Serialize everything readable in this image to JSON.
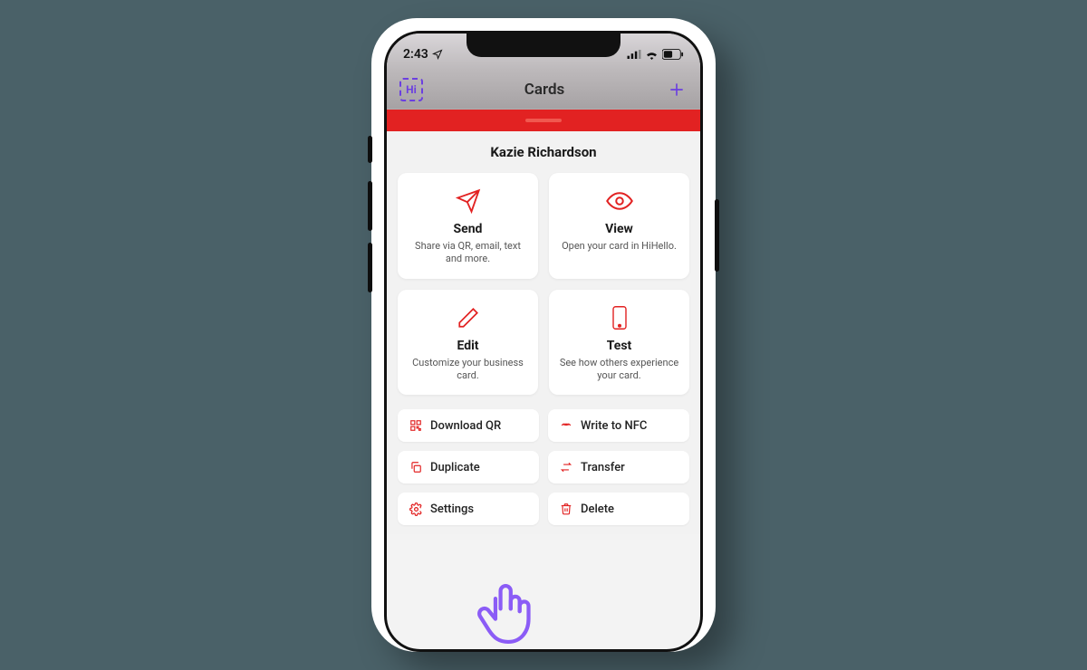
{
  "status": {
    "time": "2:43"
  },
  "nav": {
    "logo_text": "Hi",
    "title": "Cards"
  },
  "card_name": "Kazie Richardson",
  "tiles": {
    "send": {
      "title": "Send",
      "sub": "Share via QR, email, text and more."
    },
    "view": {
      "title": "View",
      "sub": "Open your card in HiHello."
    },
    "edit": {
      "title": "Edit",
      "sub": "Customize your business card."
    },
    "test": {
      "title": "Test",
      "sub": "See how others experience your card."
    }
  },
  "actions": {
    "download_qr": "Download QR",
    "write_nfc": "Write to NFC",
    "duplicate": "Duplicate",
    "transfer": "Transfer",
    "settings": "Settings",
    "delete": "Delete"
  },
  "colors": {
    "accent": "#e22222",
    "purple": "#8b5cf6"
  }
}
